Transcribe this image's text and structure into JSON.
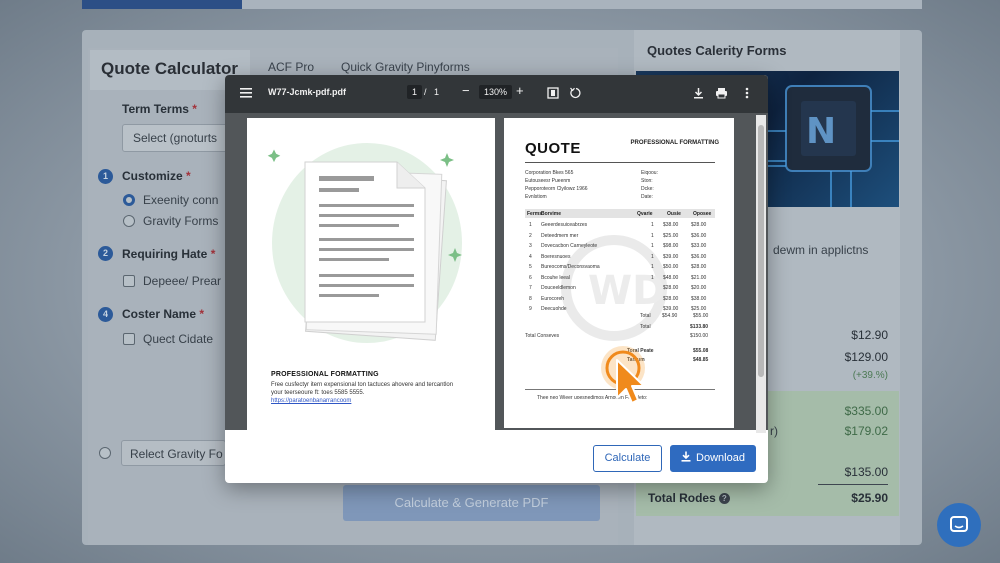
{
  "background": {
    "left_tab_active": "Quote Calculator",
    "tabs": [
      "ACF Pro",
      "Quick Gravity Pinyforms"
    ],
    "form": {
      "term_terms_label": "Term Terms",
      "select_placeholder": "Select (gnoturts",
      "customize_label": "Customize",
      "radio_options": [
        "Exeenity conn",
        "Gravity Forms"
      ],
      "requiring_label": "Requiring Hate",
      "requiring_option": "Depeee/ Prear (",
      "coster_label": "Coster Name",
      "coster_option": "Quect Cidate",
      "relect_placeholder": "Relect Gravity Fo",
      "steps": [
        "1",
        "2",
        "4"
      ],
      "generate_button": "Calculate & Generate PDF"
    },
    "right": {
      "title": "Quotes Calerity Forms",
      "note": "dewm in applictns",
      "prices": [
        "$12.90",
        "$129.00",
        "(+39.%)",
        "$335.00",
        "$179.02",
        "$135.00",
        "$25.90"
      ],
      "partial_label": "r)",
      "total_label": "Total Rodes"
    }
  },
  "modal": {
    "viewer": {
      "filename": "W77-Jcmk-pdf.pdf",
      "page_current": "1",
      "page_sep": "/",
      "page_total": "1",
      "zoom": "130%"
    },
    "left_page": {
      "heading": "PROFESSIONAL FORMATTING",
      "line1": "Free cusfectyr itern expensional ton tactuces ahovere and tercantlon",
      "line2": "your teerseoure ft: toes 5585 5555.",
      "link": "https://paratoenbanarrancoom"
    },
    "right_page": {
      "title": "QUOTE",
      "corner": "PROFESSIONAL FORMATTING",
      "meta_left": [
        "Corporation Bkes 565",
        "Eutouseesr Pueenm",
        "Pepporoteorn Clyilowz 1966",
        "Evnlstiom"
      ],
      "meta_right": [
        "Eiqoou:",
        "Ston:",
        "Dcke:",
        "Date:"
      ],
      "table_head": [
        "Ferms",
        "Borvime",
        "Qvarie",
        "Ousie",
        "Oposee"
      ],
      "rows": [
        {
          "n": "1",
          "item": "Geeerdesuiceabrzes",
          "q": "1",
          "p": "$38.00",
          "t": "$28.00"
        },
        {
          "n": "2",
          "item": "Deteedmem mer",
          "q": "1",
          "p": "$25.00",
          "t": "$36.00"
        },
        {
          "n": "3",
          "item": "Dovecacbon Carneyleote",
          "q": "1",
          "p": "$98.00",
          "t": "$33.00"
        },
        {
          "n": "4",
          "item": "Boeresnuoes",
          "q": "1",
          "p": "$39.00",
          "t": "$36.00"
        },
        {
          "n": "5",
          "item": "Bureocoms/Deconsvaoma",
          "q": "1",
          "p": "$50.00",
          "t": "$28.00"
        },
        {
          "n": "6",
          "item": "Bcouhe leeal",
          "q": "1",
          "p": "$48.00",
          "t": "$21.00"
        },
        {
          "n": "7",
          "item": "Douceeldlemon",
          "q": "",
          "p": "$28.00",
          "t": "$20.00"
        },
        {
          "n": "8",
          "item": "Eurocoreh",
          "q": "",
          "p": "$28.00",
          "t": "$38.00"
        },
        {
          "n": "9",
          "item": "Deecuohde",
          "q": "",
          "p": "$39.00",
          "t": "$25.00"
        }
      ],
      "subtotal_label": "Total",
      "subtotal_val": "$54.90",
      "subtotal_val2": "$55.00",
      "total_label": "Total",
      "total_val": "$133.80",
      "conversion_label": "Total Conseves",
      "conversion_val": "$150.00",
      "grand1_label": "Toral Peate",
      "grand1_val": "$55.08",
      "grand2_label": "Tantum",
      "grand2_val": "$48.85",
      "footer": "Thee neo Wieer uoesnedimos Arnouen Ferseleto:"
    },
    "buttons": {
      "calculate": "Calculate",
      "download": "Download"
    }
  },
  "colors": {
    "accent": "#2f6bc0",
    "viewer_bar": "#323639",
    "cursor": "#f08a1c"
  }
}
